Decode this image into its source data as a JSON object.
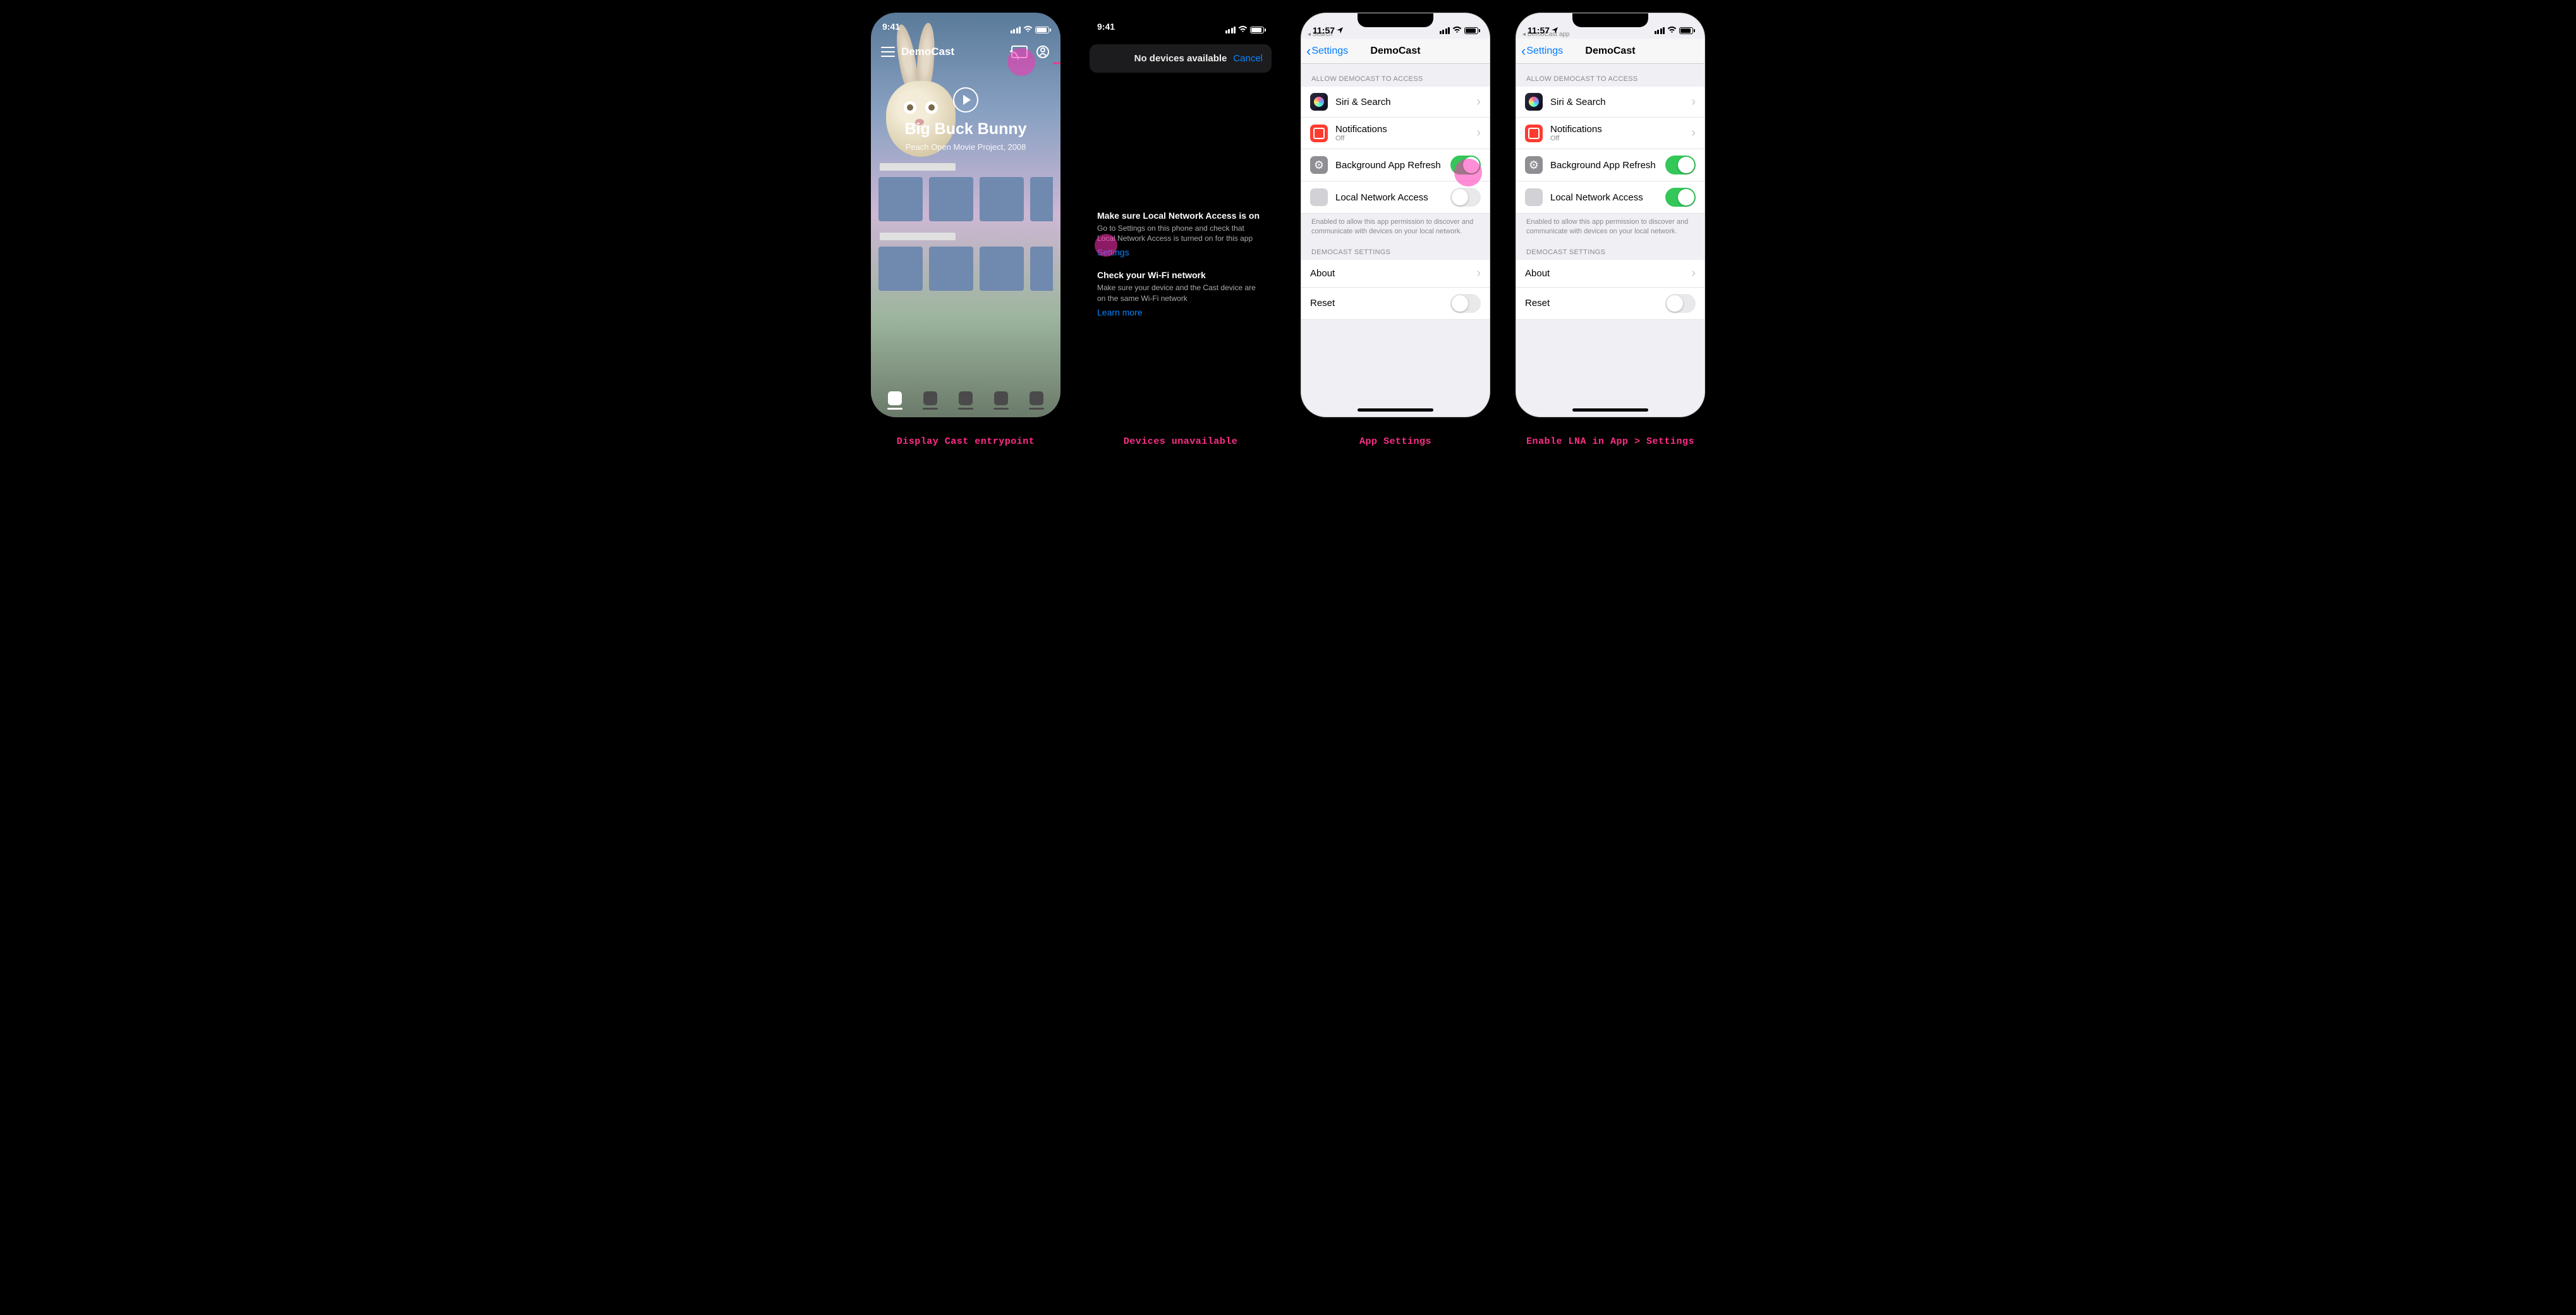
{
  "captions": {
    "p1": "Display Cast entrypoint",
    "p2": "Devices unavailable",
    "p3": "App Settings",
    "p4": "Enable LNA in App > Settings"
  },
  "status": {
    "time_941": "9:41",
    "time_1157": "11:57",
    "bc_search": "◂ Search",
    "bc_app": "◂ DemoCast app"
  },
  "app": {
    "name": "DemoCast",
    "hero": {
      "title": "Big Buck Bunny",
      "sub": "Peach Open Movie Project, 2008"
    }
  },
  "sheet": {
    "title": "No devices available",
    "cancel": "Cancel"
  },
  "info": {
    "h1": "Make sure Local Network Access is on",
    "p1": "Go to Settings on this phone and check that Local Network Access is turned on for this app",
    "settings_link": "Settings",
    "h2": "Check your Wi-Fi network",
    "p2": "Make sure your device and the Cast device are on the same Wi-Fi network",
    "learn_link": "Learn more"
  },
  "settings": {
    "back": "Settings",
    "title": "DemoCast",
    "section_access": "ALLOW DEMOCAST TO ACCESS",
    "siri": "Siri & Search",
    "notif": "Notifications",
    "notif_sub": "Off",
    "bgrefresh": "Background App Refresh",
    "lna": "Local Network Access",
    "lna_note": "Enabled to allow this app permission to discover and communicate with devices on your local network.",
    "section_app": "DEMOCAST SETTINGS",
    "about": "About",
    "reset": "Reset"
  }
}
